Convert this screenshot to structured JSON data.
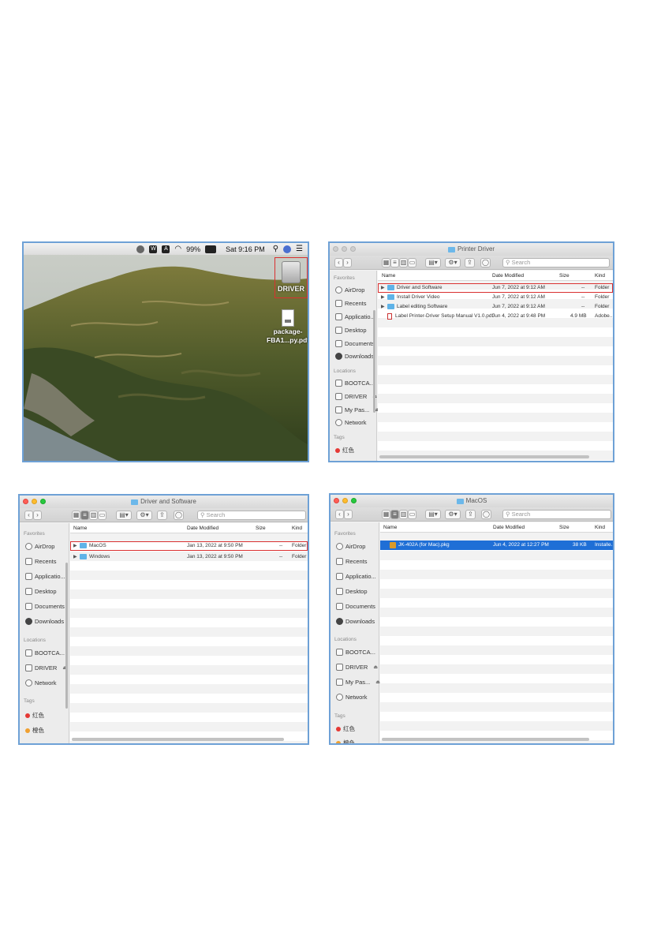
{
  "desktop": {
    "menubar": {
      "battery": "99%",
      "clock": "Sat 9:16 PM"
    },
    "icons": [
      {
        "label": "DRIVER"
      },
      {
        "label_line1": "package-",
        "label_line2": "FBA1...py.pdf"
      }
    ]
  },
  "window_root": {
    "title": "Printer Driver",
    "search_placeholder": "Search",
    "columns": {
      "name": "Name",
      "date": "Date Modified",
      "size": "Size",
      "kind": "Kind"
    },
    "rows": [
      {
        "name": "Driver and Software",
        "date": "Jun 7, 2022 at 9:12 AM",
        "size": "--",
        "kind": "Folder"
      },
      {
        "name": "Install Driver Video",
        "date": "Jun 7, 2022 at 9:12 AM",
        "size": "--",
        "kind": "Folder"
      },
      {
        "name": "Label editing Software",
        "date": "Jun 7, 2022 at 9:12 AM",
        "size": "--",
        "kind": "Folder"
      },
      {
        "name": "Label Printer-Driver Setup Manual V1.0.pdf",
        "date": "Jun 4, 2022 at 9:48 PM",
        "size": "4.9 MB",
        "kind": "Adobe...F"
      }
    ],
    "sidebar": {
      "favorites_header": "Favorites",
      "favorites": [
        "AirDrop",
        "Recents",
        "Applicatio...",
        "Desktop",
        "Documents",
        "Downloads"
      ],
      "locations_header": "Locations",
      "locations": [
        "BOOTCA...",
        "DRIVER",
        "My Pas...",
        "Network"
      ],
      "tags_header": "Tags",
      "tags": [
        "红色"
      ]
    }
  },
  "window_driver": {
    "title": "Driver and Software",
    "search_placeholder": "Search",
    "columns": {
      "name": "Name",
      "date": "Date Modified",
      "size": "Size",
      "kind": "Kind"
    },
    "rows": [
      {
        "name": "MacOS",
        "date": "Jan 13, 2022 at 9:50 PM",
        "size": "--",
        "kind": "Folder"
      },
      {
        "name": "Windows",
        "date": "Jan 13, 2022 at 9:50 PM",
        "size": "--",
        "kind": "Folder"
      }
    ],
    "sidebar": {
      "favorites_header": "Favorites",
      "favorites": [
        "AirDrop",
        "Recents",
        "Applicatio...",
        "Desktop",
        "Documents",
        "Downloads"
      ],
      "locations_header": "Locations",
      "locations": [
        "BOOTCA...",
        "DRIVER",
        "Network"
      ],
      "tags_header": "Tags",
      "tags": [
        "红色",
        "橙色"
      ]
    }
  },
  "window_macos": {
    "title": "MacOS",
    "search_placeholder": "Search",
    "columns": {
      "name": "Name",
      "date": "Date Modified",
      "size": "Size",
      "kind": "Kind"
    },
    "rows": [
      {
        "name": "JK-402A (for Mac).pkg",
        "date": "Jun 4, 2022 at 12:27 PM",
        "size": "38 KB",
        "kind": "Installe..."
      }
    ],
    "sidebar": {
      "favorites_header": "Favorites",
      "favorites": [
        "AirDrop",
        "Recents",
        "Applicatio...",
        "Desktop",
        "Documents",
        "Downloads"
      ],
      "locations_header": "Locations",
      "locations": [
        "BOOTCA...",
        "DRIVER",
        "My Pas...",
        "Network"
      ],
      "tags_header": "Tags",
      "tags": [
        "红色",
        "橙色"
      ]
    }
  },
  "colors": {
    "highlight_box": "#d93030",
    "selection": "#1f6fd6",
    "panel_border": "#6ea1d6",
    "folder": "#5fb3e8"
  },
  "icons": [
    "apple-menu-icon",
    "wifi-icon",
    "battery-icon",
    "search-icon",
    "siri-icon",
    "list-icon",
    "drive-icon",
    "pdf-file-icon",
    "folder-icon",
    "package-icon"
  ]
}
